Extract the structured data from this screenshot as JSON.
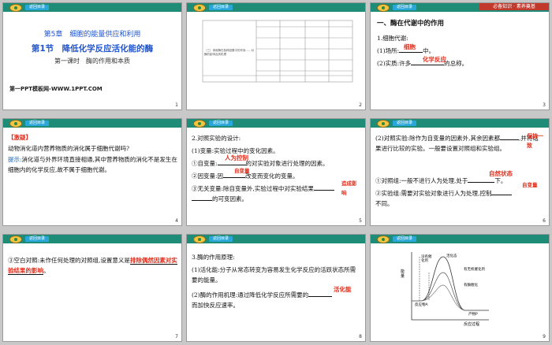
{
  "header_tag": "返回目录",
  "slides": [
    {
      "page": "1",
      "chapter": "第5章　细胞的能量供应和利用",
      "section": "第1节　降低化学反应活化能的酶",
      "lesson": "第一课时　酶的作用和本质",
      "template": "第一PPT模板网-WWW.1PPT.COM"
    },
    {
      "page": "2",
      "table_text": "（三）请用酶在各种因素中的作用……对酶的影响及其机理"
    },
    {
      "page": "3",
      "red_tag": "必备知识 · 素养奠基",
      "title": "一、酶在代谢中的作用",
      "item1": "1.细胞代谢:",
      "item1_1": "(1)场所:",
      "item1_1_end": "中。",
      "item1_1_ans": "细胞",
      "item1_2": "(2)实质:许多",
      "item1_2_end": "的总称。",
      "item1_2_ans": "化学反应"
    },
    {
      "page": "4",
      "tag": "【激疑】",
      "question": "动物消化道内营养物质的消化属于细胞代谢吗?",
      "hint_label": "提示:",
      "hint": "消化道与外界环境直接相通,其中营养物质的消化不是发生在细胞内的化学反应,故不属于细胞代谢。"
    },
    {
      "page": "5",
      "title": "2.对照实验的设计:",
      "l1": "(1)变量:实验过程中的变化因素。",
      "l2a": "①自变量:",
      "l2b": "的对实验对象进行处理的因素。",
      "l2_ans": "人为控制",
      "l3a": "②因变量:因",
      "l3b": "改变而变化的变量。",
      "l3_ans": "自变量",
      "l4a": "③无关变量:除自变量外,实验过程中对实验结果",
      "l4b": "的可变因素。",
      "l4_ans": "造成影响"
    },
    {
      "page": "6",
      "l1a": "(2)对照实验:除作为自变量的因素外,其余因素都",
      "l1b": ",并将结果进行比较的实验。一般要设置对照组和实验组。",
      "l1_ans": "保持一致",
      "l2a": "①对照组:一般不进行人为处理,处于",
      "l2b": "下。",
      "l2_ans": "自然状态",
      "l3a": "②实验组:需要对实验对象进行人为处理,控制",
      "l3b": "不同。",
      "l3_ans": "自变量"
    },
    {
      "page": "7",
      "l1a": "③空白对照:未作任何处理的对照组,设置意义是",
      "l1_ans": "排除偶然因素对实验结果的影响",
      "l1b": "。"
    },
    {
      "page": "8",
      "title": "3.酶的作用原理:",
      "l1": "(1)活化能:分子从常态转变为容易发生化学反应的活跃状态所需要的能量。",
      "l2a": "(2)酶的作用机理:通过降低化学反应所需要的",
      "l2b": "而加快反应速率。",
      "l2_ans": "活化能"
    },
    {
      "page": "9",
      "y_label": "能量",
      "x_label": "反应过程",
      "l_no_cat": "没有催化剂",
      "l_activated": "活化态",
      "l_inorganic": "有无机催化剂",
      "l_enzyme": "有酶催化",
      "l_reactant": "反应物A",
      "l_product": "产物P"
    }
  ]
}
